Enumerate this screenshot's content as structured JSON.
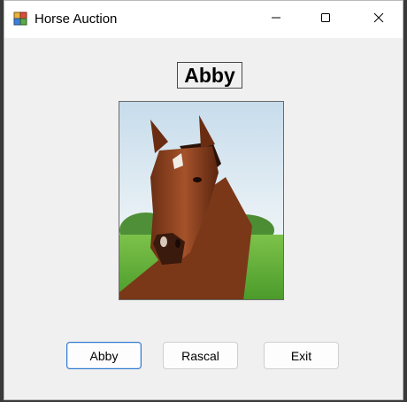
{
  "window": {
    "title": "Horse Auction",
    "app_icon": "winforms-app-icon",
    "controls": {
      "minimize": "minimize-icon",
      "maximize": "maximize-icon",
      "close": "close-icon"
    }
  },
  "main": {
    "horse_name": "Abby",
    "picture": {
      "subject": "horse-photo"
    },
    "buttons": [
      {
        "label": "Abby"
      },
      {
        "label": "Rascal"
      },
      {
        "label": "Exit"
      }
    ]
  },
  "colors": {
    "accent": "#2f79d0",
    "background": "#f0f0f0"
  }
}
